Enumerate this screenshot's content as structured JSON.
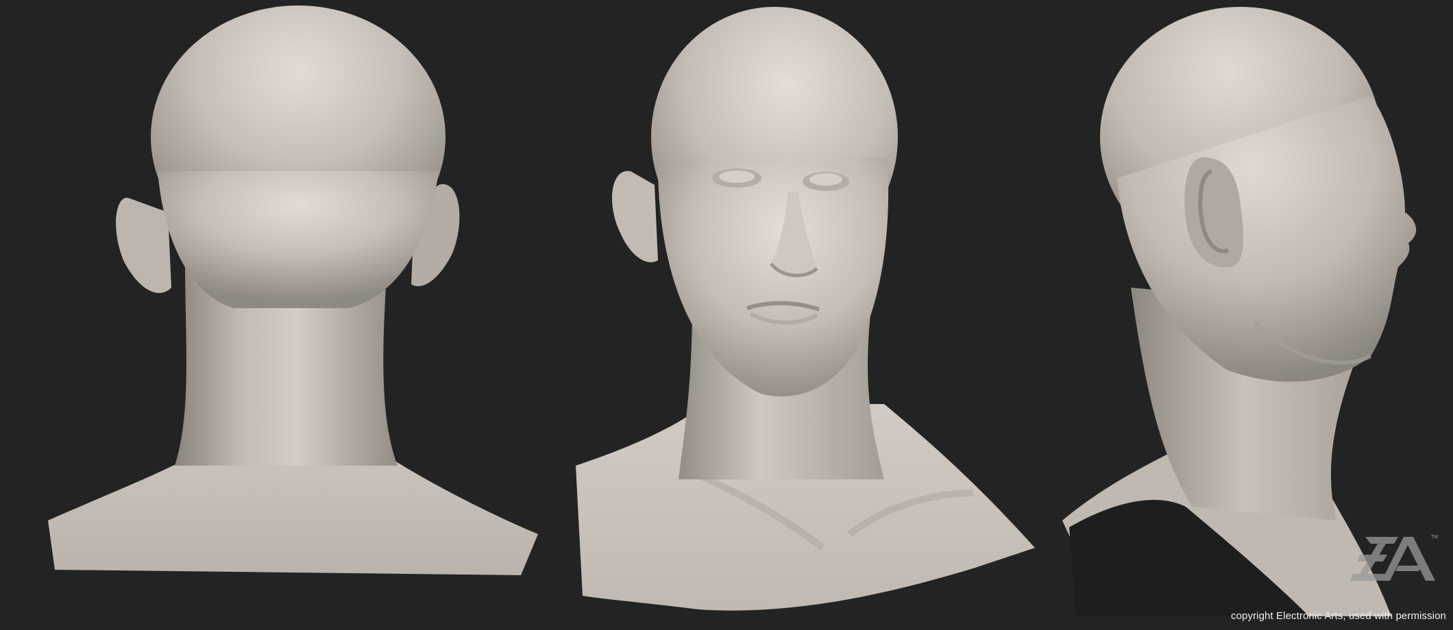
{
  "image": {
    "background_color": "#232323",
    "clay_color": "#c8c1ba",
    "views": [
      {
        "id": "back",
        "description": "back-view"
      },
      {
        "id": "front",
        "description": "three-quarter-front-view"
      },
      {
        "id": "side",
        "description": "right-profile-view"
      }
    ]
  },
  "watermark": {
    "logo_text": "EA",
    "trademark": "TM"
  },
  "copyright": {
    "text": "copyright Electronic Arts, used with permission"
  }
}
